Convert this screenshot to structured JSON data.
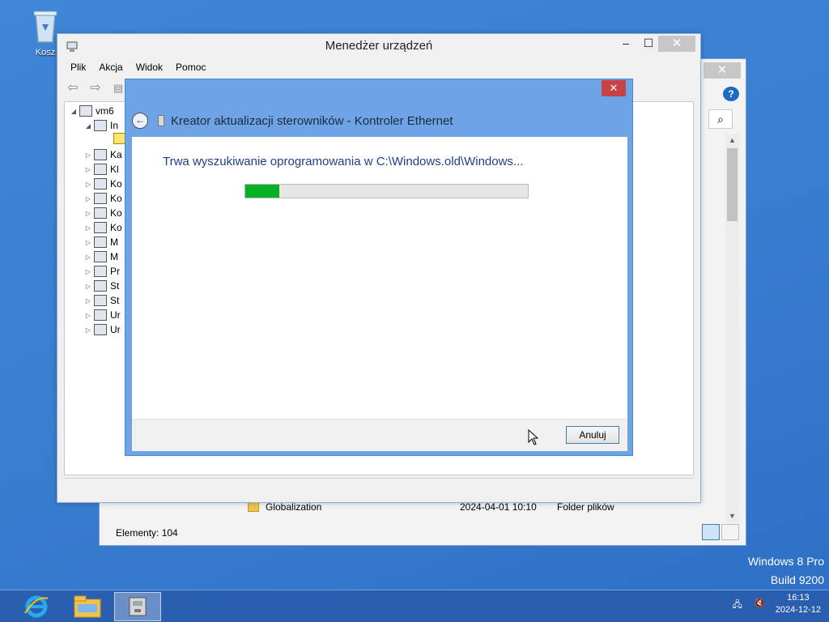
{
  "desktop": {
    "recycle_bin_label": "Kosz",
    "watermark_line1": "Windows 8 Pro",
    "watermark_line2": "Build 9200"
  },
  "explorer": {
    "close_label": "✕",
    "help_icon": "?",
    "search_icon": "⌕",
    "file_row": {
      "name": "Globalization",
      "date": "2024-04-01 10:10",
      "type": "Folder plików"
    },
    "status": "Elementy: 104"
  },
  "device_manager": {
    "title": "Menedżer urządzeń",
    "menu": [
      "Plik",
      "Akcja",
      "Widok",
      "Pomoc"
    ],
    "minimize_label": "–",
    "maximize_label": "☐",
    "close_label": "✕",
    "tree": {
      "root": "vm6",
      "expanded": "In",
      "items": [
        "Ka",
        "Kl",
        "Ko",
        "Ko",
        "Ko",
        "Ko",
        "M",
        "M",
        "Pr",
        "St",
        "St",
        "Ur",
        "Ur"
      ]
    }
  },
  "wizard": {
    "title": "Kreator aktualizacji sterowników - Kontroler Ethernet",
    "message": "Trwa wyszukiwanie oprogramowania w C:\\Windows.old\\Windows...",
    "progress": 0.12,
    "cancel_label": "Anuluj",
    "close_label": "✕",
    "back_label": "←"
  },
  "taskbar": {
    "apps": [
      "internet-explorer",
      "file-explorer",
      "device-manager"
    ],
    "time": "16:13",
    "date": "2024-12-12"
  },
  "colors": {
    "progress_green": "#06b025",
    "wizard_frame": "#6ea3e5",
    "close_red": "#c74343",
    "desktop_blue": "#3a7fd2"
  }
}
